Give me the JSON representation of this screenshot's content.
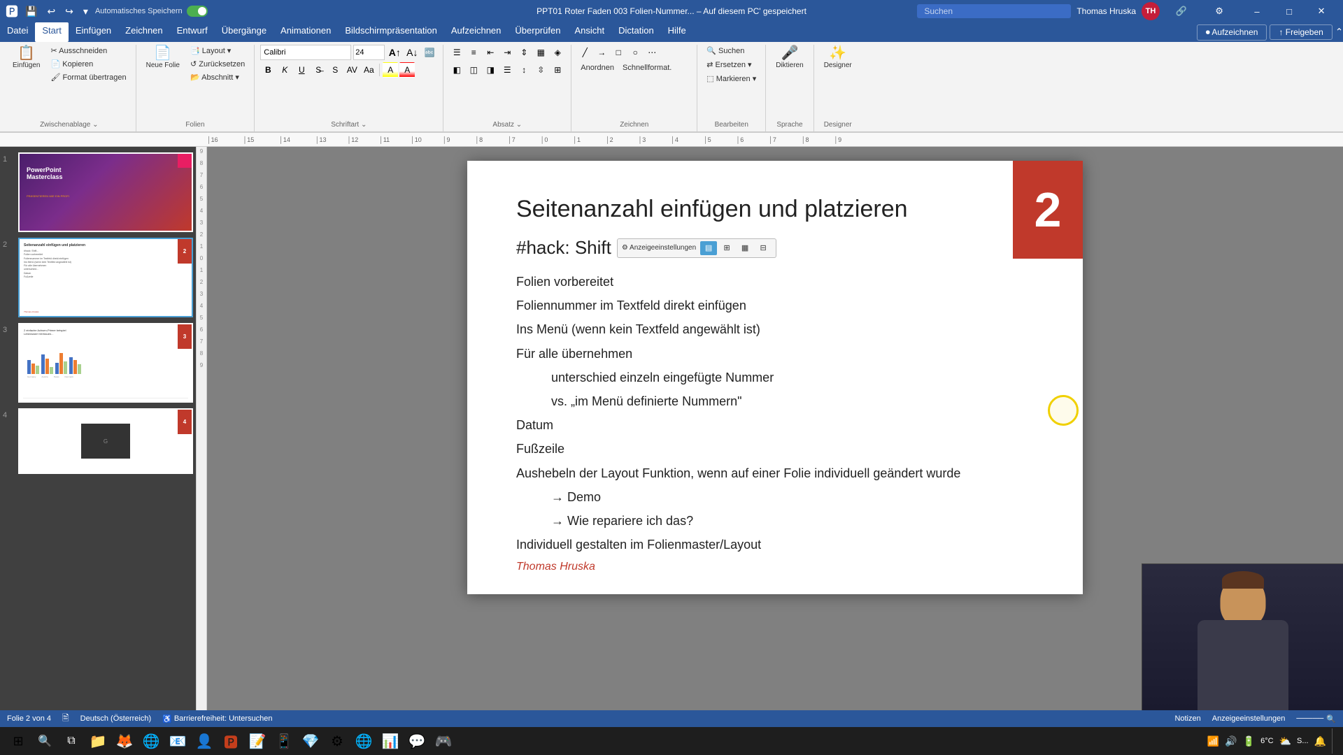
{
  "titlebar": {
    "autosave": "Automatisches Speichern",
    "filename": "PPT01 Roter Faden 003 Folien-Nummer... – Auf diesem PC' gespeichert",
    "search_placeholder": "Suchen",
    "user": "Thomas Hruska",
    "user_initials": "TH",
    "minimize": "–",
    "maximize": "□",
    "close": "✕"
  },
  "menubar": {
    "items": [
      "Datei",
      "Start",
      "Einfügen",
      "Zeichnen",
      "Entwurf",
      "Übergänge",
      "Animationen",
      "Bildschirmpräsentation",
      "Aufzeichnen",
      "Überprüfen",
      "Ansicht",
      "Dictation",
      "Hilfe"
    ],
    "active": "Start",
    "right_items": [
      "Aufzeichnen",
      "Freigeben"
    ]
  },
  "ribbon": {
    "groups": [
      {
        "label": "Zwischenablage",
        "buttons": [
          "Einfügen",
          "Ausschneiden",
          "Kopieren",
          "Format übertragen"
        ]
      },
      {
        "label": "Folien",
        "buttons": [
          "Neue Folie",
          "Layout",
          "Zurücksetzen",
          "Abschnitt"
        ]
      },
      {
        "label": "Schriftart",
        "font": "Calibri",
        "size": "24",
        "format_buttons": [
          "B",
          "K",
          "U",
          "S"
        ]
      },
      {
        "label": "Absatz"
      },
      {
        "label": "Zeichnen"
      },
      {
        "label": "Bearbeiten",
        "buttons": [
          "Suchen",
          "Ersetzen",
          "Markieren"
        ]
      },
      {
        "label": "Sprache",
        "buttons": [
          "Diktieren"
        ]
      },
      {
        "label": "Designer",
        "buttons": [
          "Designer"
        ]
      }
    ]
  },
  "slides": [
    {
      "number": "1",
      "title": "PowerPoint Masterclass",
      "subtitle": "PRÄSENTIEREN WIE EIN PROFI",
      "corner_num": ""
    },
    {
      "number": "2",
      "title": "Seitenanzahl einfügen und platzieren",
      "active": true,
      "corner_num": "2"
    },
    {
      "number": "3",
      "corner_num": "3"
    },
    {
      "number": "4",
      "corner_num": "4"
    }
  ],
  "slide_main": {
    "title": "Seitenanzahl einfügen und platzieren",
    "hack_prefix": "#hack: Shift",
    "display_popup_label": "Anzeigeeinstellungen",
    "content_lines": [
      "Folien vorbereitet",
      "Foliennummer im Textfeld direkt einfügen",
      "Ins Menü (wenn kein Textfeld angewählt ist)",
      "Für alle übernehmen",
      "unterschied  einzeln eingefügte Nummer",
      "vs. „im Menü definierte Nummern\"",
      "Datum",
      "Fußzeile",
      "Aushebeln der Layout Funktion, wenn auf einer Folie individuell geändert wurde",
      "→ Demo",
      "→ Wie repariere ich das?",
      "Individuell gestalten im Folienmaster/Layout"
    ],
    "author": "Thomas Hruska",
    "slide_number": "2"
  },
  "statusbar": {
    "slide_info": "Folie 2 von 4",
    "language": "Deutsch (Österreich)",
    "accessibility": "Barrierefreiheit: Untersuchen",
    "notes": "Notizen",
    "display_settings": "Anzeigeeinstellungen"
  },
  "taskbar": {
    "time": "6°C  S...",
    "icons": [
      "⊞",
      "🔍",
      "📁",
      "🦊",
      "🌐",
      "📧",
      "👤",
      "📊",
      "🎵",
      "📝",
      "📱",
      "⚙️",
      "🔷",
      "🎨",
      "🌐",
      "📊",
      "💬",
      "🎮"
    ]
  }
}
